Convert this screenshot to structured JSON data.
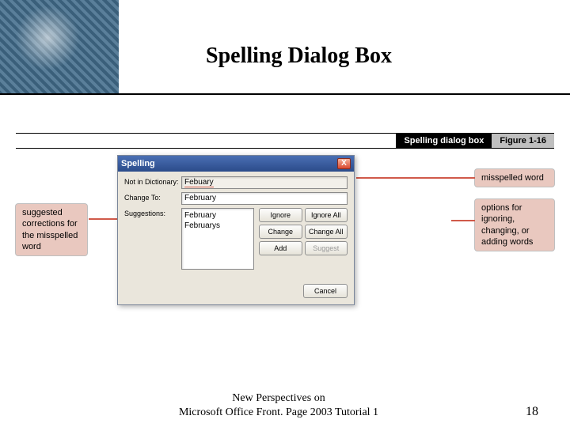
{
  "header": {
    "title": "Spelling Dialog Box"
  },
  "figure": {
    "caption": "Spelling dialog box",
    "number": "Figure 1-16"
  },
  "callouts": {
    "left": "suggested corrections for the misspelled word",
    "right_top": "misspelled word",
    "right_mid": "options for ignoring, changing, or adding words"
  },
  "dialog": {
    "title": "Spelling",
    "close": "X",
    "labels": {
      "not_in_dict": "Not in Dictionary:",
      "change_to": "Change To:",
      "suggestions": "Suggestions:"
    },
    "values": {
      "not_in_dict": "Febuary",
      "change_to": "February",
      "suggestions": [
        "February",
        "Februarys"
      ]
    },
    "buttons": {
      "ignore": "Ignore",
      "ignore_all": "Ignore All",
      "change": "Change",
      "change_all": "Change All",
      "add": "Add",
      "suggest": "Suggest",
      "cancel": "Cancel"
    }
  },
  "footer": {
    "line1": "New Perspectives on",
    "line2": "Microsoft Office Front. Page 2003 Tutorial 1",
    "slide_number": "18"
  }
}
